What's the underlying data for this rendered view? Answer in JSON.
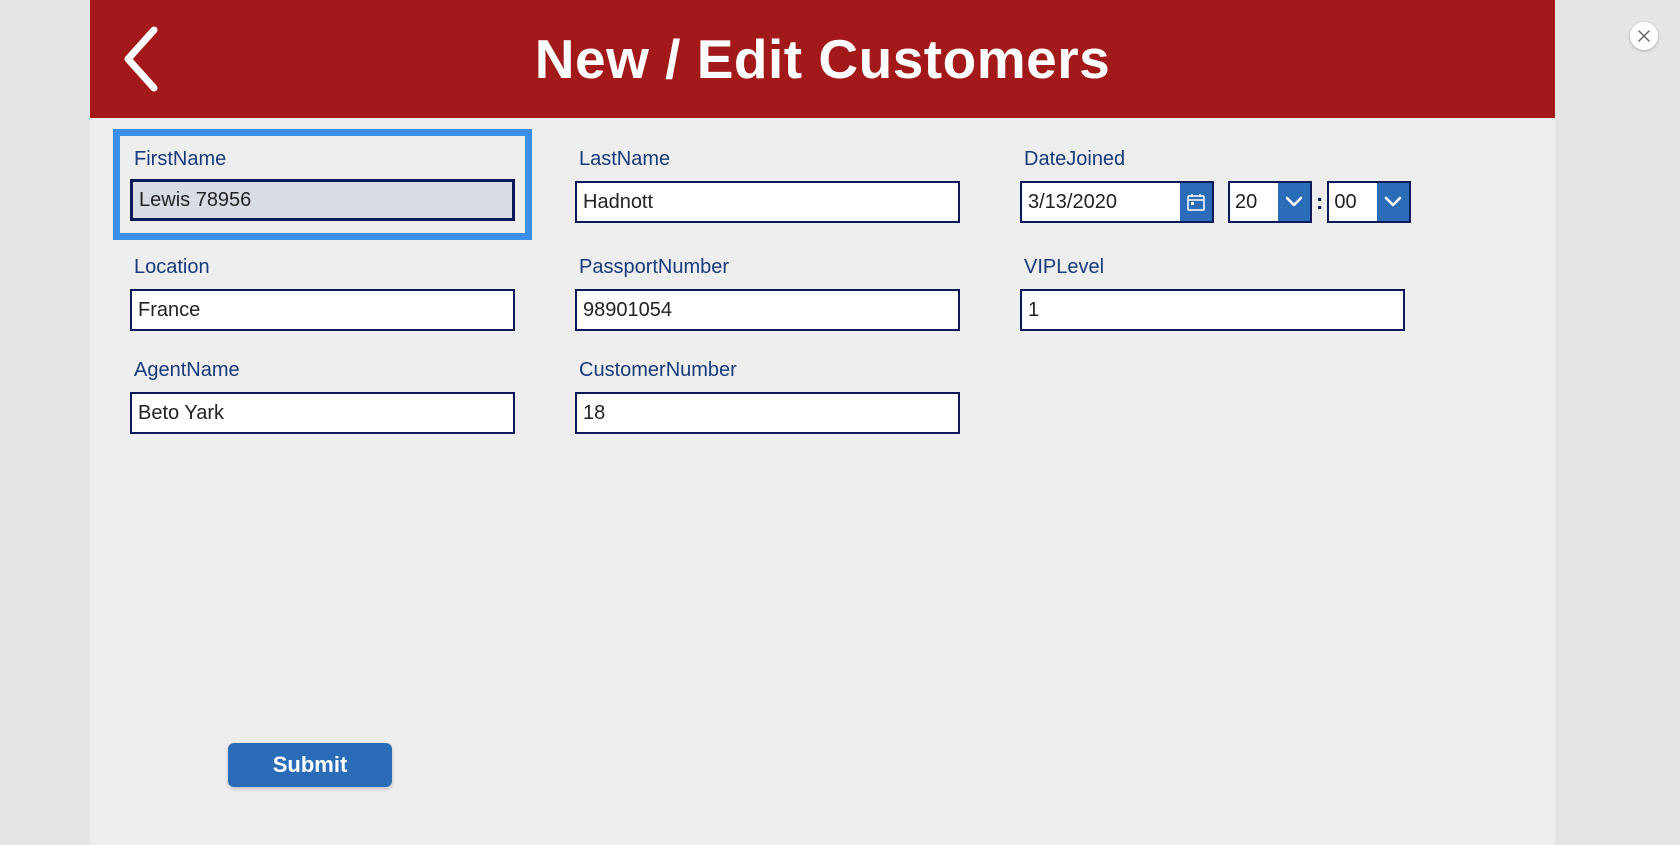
{
  "header": {
    "title": "New / Edit Customers"
  },
  "fields": {
    "firstName": {
      "label": "FirstName",
      "value": "Lewis 78956"
    },
    "lastName": {
      "label": "LastName",
      "value": "Hadnott"
    },
    "dateJoined": {
      "label": "DateJoined",
      "date": "3/13/2020",
      "hour": "20",
      "minute": "00",
      "separator": ":"
    },
    "location": {
      "label": "Location",
      "value": "France"
    },
    "passportNumber": {
      "label": "PassportNumber",
      "value": "98901054"
    },
    "vipLevel": {
      "label": "VIPLevel",
      "value": "1"
    },
    "agentName": {
      "label": "AgentName",
      "value": "Beto Yark"
    },
    "customerNumber": {
      "label": "CustomerNumber",
      "value": "18"
    }
  },
  "buttons": {
    "submit": "Submit"
  }
}
